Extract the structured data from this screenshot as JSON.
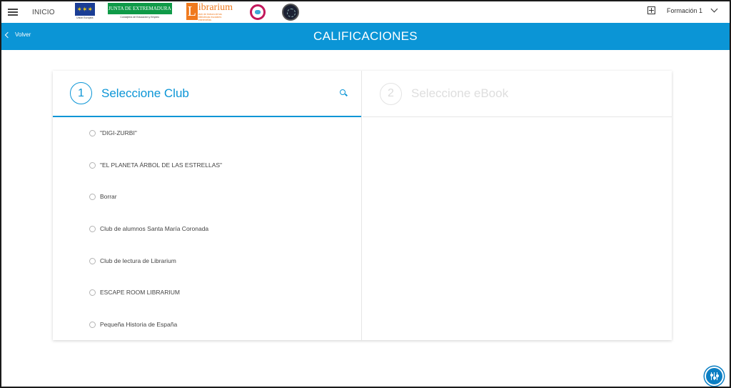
{
  "topbar": {
    "home_label": "INICIO",
    "logos": {
      "eu_caption": "Unión Europea",
      "junta_title": "JUNTA DE EXTREMADURA",
      "junta_subtitle": "Consejería de Educación y Empleo",
      "librarium_letter": "L",
      "librarium_word": "ibrarium",
      "librarium_tagline": "club de lectura de las bibliotecas escolares extremeñas"
    },
    "user_name": "Formación 1"
  },
  "header": {
    "back_label": "Volver",
    "title": "CALIFICACIONES"
  },
  "steps": [
    {
      "number": "1",
      "title": "Seleccione Club",
      "active": true
    },
    {
      "number": "2",
      "title": "Seleccione eBook",
      "active": false
    }
  ],
  "clubs": [
    "\"DIGI-ZURBI\"",
    "\"EL PLANETA ÁRBOL DE LAS ESTRELLAS\"",
    "Borrar",
    "Club de alumnos Santa María Coronada",
    "Club de lectura de Librarium",
    "ESCAPE ROOM LIBRARIUM",
    "Pequeña Historia de España"
  ],
  "colors": {
    "accent": "#0b95d6",
    "eu_blue": "#1a3d95",
    "junta_green": "#0f9a48",
    "librarium_orange": "#f07a1e"
  },
  "icons": [
    "menu-icon",
    "add-box-icon",
    "chevron-down-icon",
    "chevron-left-icon",
    "search-icon",
    "accessibility-icon"
  ]
}
